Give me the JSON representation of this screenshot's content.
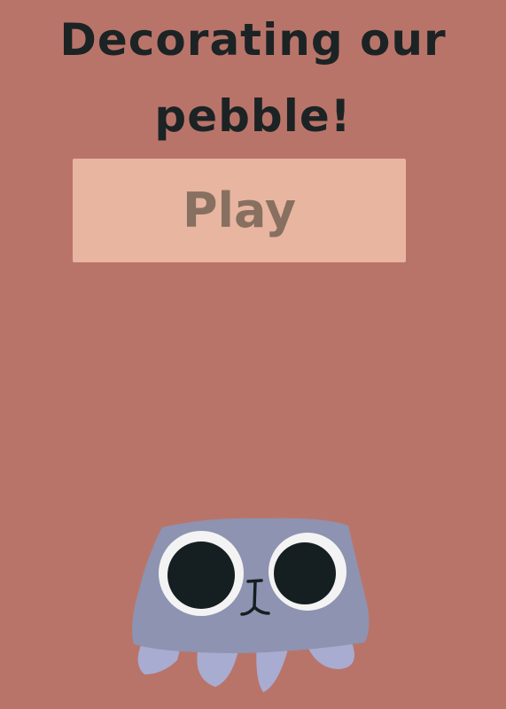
{
  "title": {
    "line1": "Decorating our",
    "line2": "pebble!"
  },
  "play_button": {
    "label": "Play"
  },
  "colors": {
    "background": "#b9746a",
    "title_text": "#1c2324",
    "button_bg": "#e8b5a0",
    "button_text": "#877060",
    "pebble_body": "#8d93b0",
    "pebble_legs": "#a8acd0",
    "eye_white": "#f4f3f4",
    "pupil": "#151f21"
  },
  "character": {
    "icon": "pebble-creature-icon"
  }
}
